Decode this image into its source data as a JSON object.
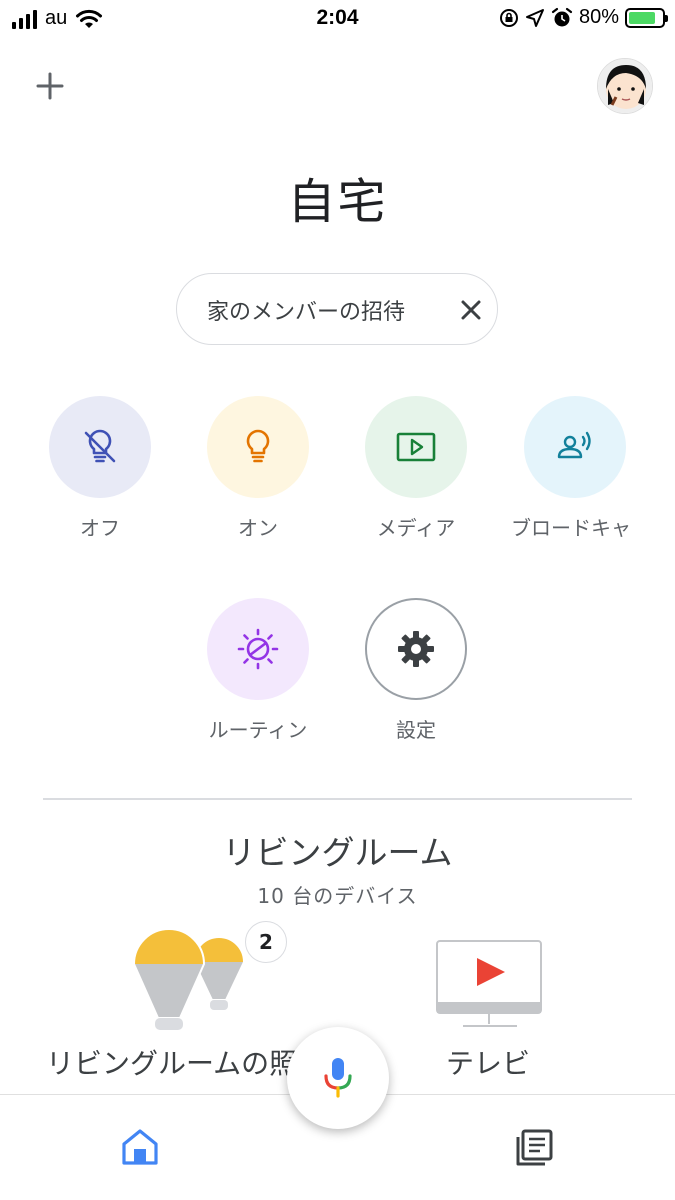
{
  "status_bar": {
    "carrier": "au",
    "time": "2:04",
    "battery_percent_text": "80%",
    "battery_level": 0.8
  },
  "header": {
    "add_icon": "plus-icon",
    "avatar_icon": "profile-avatar"
  },
  "home": {
    "title": "自宅"
  },
  "invite_chip": {
    "label": "家のメンバーの招待",
    "close_icon": "close-icon"
  },
  "actions": [
    {
      "label": "オフ",
      "icon": "lightbulb-off-icon",
      "bg": "#e8eaf6",
      "color": "#3f51b5"
    },
    {
      "label": "オン",
      "icon": "lightbulb-icon",
      "bg": "#fef6e0",
      "color": "#e37400"
    },
    {
      "label": "メディア",
      "icon": "play-icon",
      "bg": "#e6f4ea",
      "color": "#188038"
    },
    {
      "label": "ブロードキャ",
      "icon": "broadcast-icon",
      "bg": "#e4f4fb",
      "color": "#12809b"
    },
    {
      "label": "ルーティン",
      "icon": "routine-icon",
      "bg": "#f3e8fd",
      "color": "#9334e6"
    },
    {
      "label": "設定",
      "icon": "gear-icon",
      "bg": "#ffffff",
      "color": "#3c4043"
    }
  ],
  "room": {
    "name": "リビングルーム",
    "device_count": "10 台のデバイス",
    "tiles": [
      {
        "label": "リビングルームの照",
        "icon": "lights-icon",
        "badge": "2",
        "bulb_color": "#f4bf3a"
      },
      {
        "label": "テレビ",
        "icon": "tv-icon",
        "play_color": "#ea4335"
      }
    ]
  },
  "bottom_nav": {
    "home_icon": "home-icon",
    "mic_icon": "mic-icon",
    "feed_icon": "feed-icon",
    "active_color": "#4285f4"
  }
}
